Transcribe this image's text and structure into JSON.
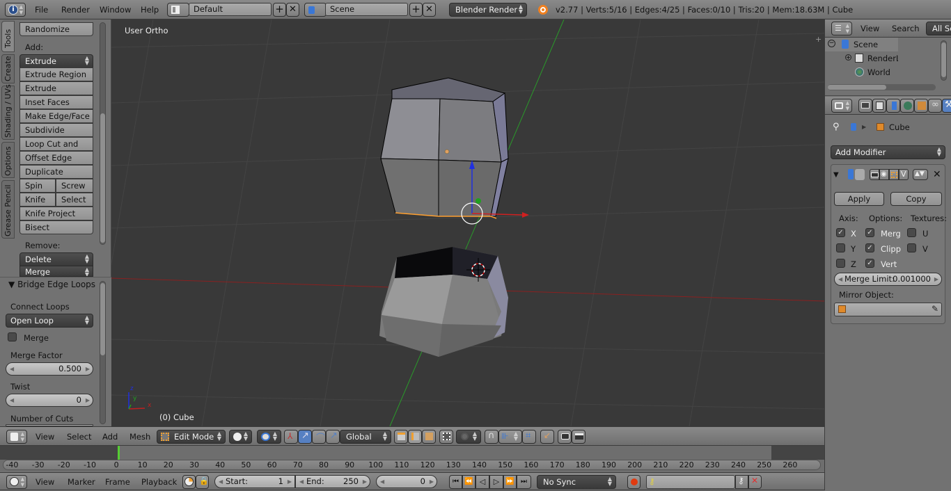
{
  "top_bar": {
    "menus": [
      "File",
      "Render",
      "Window",
      "Help"
    ],
    "layout": "Default",
    "scene": "Scene",
    "render_engine": "Blender Render",
    "stats": "v2.77 | Verts:5/16 | Edges:4/25 | Faces:0/10 | Tris:20 | Mem:18.63M | Cube"
  },
  "tool_tabs": [
    "Tools",
    "Create",
    "Shading / UVs",
    "Options",
    "Grease Pencil"
  ],
  "tools": {
    "randomize": "Randomize",
    "add_label": "Add:",
    "extrude": "Extrude",
    "buttons": [
      "Extrude Region",
      "Extrude Individual",
      "Inset Faces",
      "Make Edge/Face",
      "Subdivide",
      "Loop Cut and Slide",
      "Offset Edge Slide",
      "Duplicate"
    ],
    "spin": "Spin",
    "screw": "Screw",
    "knife": "Knife",
    "select": "Select",
    "knife_project": "Knife Project",
    "bisect": "Bisect",
    "remove_label": "Remove:",
    "delete": "Delete",
    "merge": "Merge"
  },
  "operator": {
    "title": "Bridge Edge Loops",
    "connect_loops_label": "Connect Loops",
    "connect_loops_value": "Open Loop",
    "merge_label": "Merge",
    "merge_checked": false,
    "merge_factor_label": "Merge Factor",
    "merge_factor": "0.500",
    "twist_label": "Twist",
    "twist": "0",
    "cuts_label": "Number of Cuts"
  },
  "viewport": {
    "view_name": "User Ortho",
    "object_info": "(0) Cube",
    "axis_x": "x",
    "axis_y": "y",
    "axis_z": "z"
  },
  "viewport_header": {
    "menus": [
      "View",
      "Select",
      "Add",
      "Mesh"
    ],
    "mode": "Edit Mode",
    "orientation": "Global"
  },
  "outliner": {
    "view": "View",
    "search": "Search",
    "filter": "All Scenes",
    "items": [
      {
        "label": "Scene",
        "icon": "scene-icon",
        "expanded": true
      },
      {
        "label": "RenderLayers",
        "icon": "render-layers-icon"
      },
      {
        "label": "World",
        "icon": "world-icon"
      }
    ]
  },
  "properties": {
    "breadcrumb_object": "Cube",
    "add_modifier": "Add Modifier",
    "apply": "Apply",
    "copy": "Copy",
    "axis_label": "Axis:",
    "options_label": "Options:",
    "textures_label": "Textures:",
    "axis": [
      {
        "label": "X",
        "checked": true
      },
      {
        "label": "Y",
        "checked": false
      },
      {
        "label": "Z",
        "checked": false
      }
    ],
    "options": [
      {
        "label": "Merg",
        "checked": true
      },
      {
        "label": "Clipp",
        "checked": true
      },
      {
        "label": "Vert",
        "checked": true
      }
    ],
    "textures": [
      {
        "label": "U",
        "checked": false
      },
      {
        "label": "V",
        "checked": false
      }
    ],
    "merge_limit_label": "Merge Limit:",
    "merge_limit": "0.001000",
    "mirror_object_label": "Mirror Object:"
  },
  "timeline": {
    "ticks": [
      "-40",
      "-30",
      "-20",
      "-10",
      "0",
      "10",
      "20",
      "30",
      "40",
      "50",
      "60",
      "70",
      "80",
      "90",
      "100",
      "110",
      "120",
      "130",
      "140",
      "150",
      "160",
      "170",
      "180",
      "190",
      "200",
      "210",
      "220",
      "230",
      "240",
      "250",
      "260"
    ],
    "current_frame_marker": 0,
    "menus": [
      "View",
      "Marker",
      "Frame",
      "Playback"
    ],
    "start_label": "Start:",
    "start": "1",
    "end_label": "End:",
    "end": "250",
    "current": "0",
    "sync": "No Sync"
  },
  "colors": {
    "viewport_bg": "#393939",
    "selection_orange": "#ffa030",
    "x_axis": "#c02020",
    "y_axis": "#20a020",
    "z_axis": "#2030e0",
    "frame_marker": "#55cc33"
  }
}
